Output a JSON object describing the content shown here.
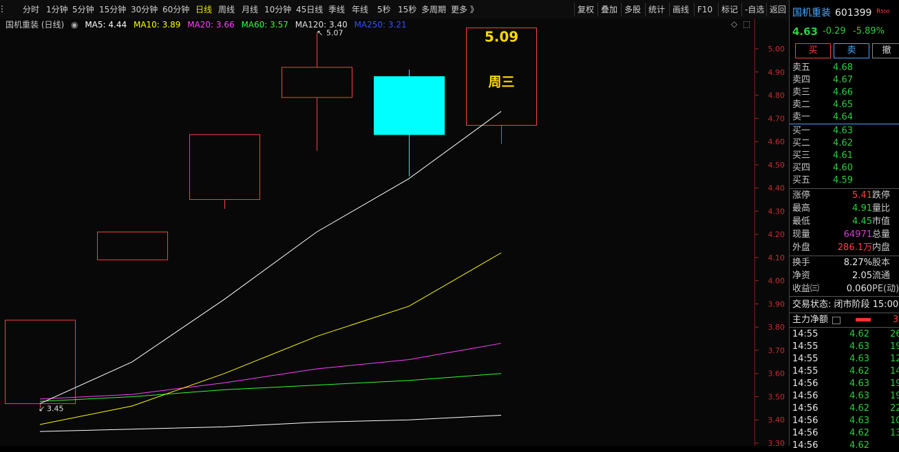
{
  "toolbar": {
    "timeframes": [
      "分时",
      "1分钟",
      "5分钟",
      "15分钟",
      "30分钟",
      "60分钟",
      "日线",
      "周线",
      "月线",
      "10分钟",
      "45日线",
      "季线",
      "年线",
      "5秒",
      "15秒",
      "多周期",
      "更多 》"
    ],
    "active": "日线",
    "right_buttons": [
      "复权",
      "叠加",
      "多股",
      "统计",
      "画线",
      "F10",
      "标记",
      "-自选",
      "返回"
    ]
  },
  "legend": {
    "title": "国机重装 (日线)",
    "ma5": "MA5: 4.44",
    "ma10": "MA10: 3.89",
    "ma20": "MA20: 3.66",
    "ma60": "MA60: 3.57",
    "ma120": "MA120: 3.40",
    "ma250": "MA250: 3.21"
  },
  "colors": {
    "up": "#ff4040",
    "down": "#00ffff",
    "ma5": "#ffffff",
    "ma10": "#ffff00",
    "ma20": "#ff40ff",
    "ma60": "#30ff30",
    "ma120": "#ffffff",
    "ma250": "#2040ff",
    "axis": "#b02020"
  },
  "chart_data": {
    "type": "candlestick",
    "ylim": [
      3.3,
      5.09
    ],
    "yticks": [
      "5.00",
      "4.90",
      "4.80",
      "4.70",
      "4.60",
      "4.50",
      "4.40",
      "4.30",
      "4.20",
      "4.10",
      "4.00",
      "3.90",
      "3.80",
      "3.70",
      "3.60",
      "3.50",
      "3.40",
      "3.30"
    ],
    "candles": [
      {
        "open": 3.47,
        "close": 3.83,
        "high": 3.83,
        "low": 3.45,
        "up": true
      },
      {
        "open": 4.09,
        "close": 4.21,
        "high": 4.21,
        "low": 4.09,
        "up": true
      },
      {
        "open": 4.35,
        "close": 4.63,
        "high": 4.63,
        "low": 4.31,
        "up": true
      },
      {
        "open": 4.79,
        "close": 4.92,
        "high": 5.07,
        "low": 4.56,
        "up": true
      },
      {
        "open": 4.88,
        "close": 4.63,
        "high": 4.91,
        "low": 4.45,
        "up": false
      },
      {
        "open": 4.67,
        "close": 5.09,
        "high": 5.09,
        "low": 4.59,
        "up": true
      }
    ],
    "ma5": [
      3.47,
      3.65,
      3.92,
      4.21,
      4.44,
      4.73
    ],
    "ma10": [
      3.38,
      3.46,
      3.6,
      3.76,
      3.89,
      4.12
    ],
    "ma20": [
      3.49,
      3.51,
      3.56,
      3.62,
      3.66,
      3.73
    ],
    "ma60": [
      3.48,
      3.5,
      3.53,
      3.55,
      3.57,
      3.6
    ],
    "ma120": [
      3.35,
      3.36,
      3.37,
      3.39,
      3.4,
      3.42
    ],
    "high_label": "5.07",
    "low_label": "3.45",
    "popup": {
      "price": "5.09",
      "day": "周三"
    }
  },
  "panel": {
    "stock_name": "国机重装",
    "stock_code": "601399",
    "badge": "R",
    "badge2": "500",
    "price": "4.63",
    "change": "-0.29",
    "pct": "-5.89%",
    "buy_btn": "买",
    "sell_btn": "卖",
    "cancel_btn": "撤",
    "asks": [
      {
        "label": "卖五",
        "price": "4.68"
      },
      {
        "label": "卖四",
        "price": "4.67"
      },
      {
        "label": "卖三",
        "price": "4.66"
      },
      {
        "label": "卖二",
        "price": "4.65"
      },
      {
        "label": "卖一",
        "price": "4.64"
      }
    ],
    "bids": [
      {
        "label": "买一",
        "price": "4.63"
      },
      {
        "label": "买二",
        "price": "4.62"
      },
      {
        "label": "买三",
        "price": "4.61"
      },
      {
        "label": "买四",
        "price": "4.60"
      },
      {
        "label": "买五",
        "price": "4.59"
      }
    ],
    "stats1": [
      {
        "l1": "涨停",
        "v": "5.41",
        "l2": "跌停",
        "c": "red"
      },
      {
        "l1": "最高",
        "v": "4.91",
        "l2": "量比",
        "c": "green"
      },
      {
        "l1": "最低",
        "v": "4.45",
        "l2": "市值",
        "c": "green"
      },
      {
        "l1": "现量",
        "v": "64971",
        "l2": "总量",
        "c": "mag"
      },
      {
        "l1": "外盘",
        "v": "286.1万",
        "l2": "内盘",
        "c": "red"
      }
    ],
    "stats2": [
      {
        "l1": "换手",
        "v": "8.27%",
        "l2": "股本"
      },
      {
        "l1": "净资",
        "v": "2.05",
        "l2": "流通"
      },
      {
        "l1": "收益㈢",
        "v": "0.060",
        "l2": "PE(动)"
      }
    ],
    "trade_status": "交易状态: 闭市阶段 15:00",
    "capital_label": "主力净额",
    "capital_val": "3",
    "ticks": [
      {
        "t": "14:55",
        "p": "4.62",
        "v": "26",
        "c": "green"
      },
      {
        "t": "14:55",
        "p": "4.63",
        "v": "19",
        "c": "green"
      },
      {
        "t": "14:55",
        "p": "4.63",
        "v": "12",
        "c": "green"
      },
      {
        "t": "14:55",
        "p": "4.62",
        "v": "14",
        "c": "green"
      },
      {
        "t": "14:56",
        "p": "4.63",
        "v": "19",
        "c": "green"
      },
      {
        "t": "14:56",
        "p": "4.63",
        "v": "19",
        "c": "green"
      },
      {
        "t": "14:56",
        "p": "4.62",
        "v": "22",
        "c": "green"
      },
      {
        "t": "14:56",
        "p": "4.63",
        "v": "10",
        "c": "green"
      },
      {
        "t": "14:56",
        "p": "4.62",
        "v": "13",
        "c": "green"
      },
      {
        "t": "14:56",
        "p": "4.62",
        "v": "",
        "c": "green"
      }
    ]
  }
}
